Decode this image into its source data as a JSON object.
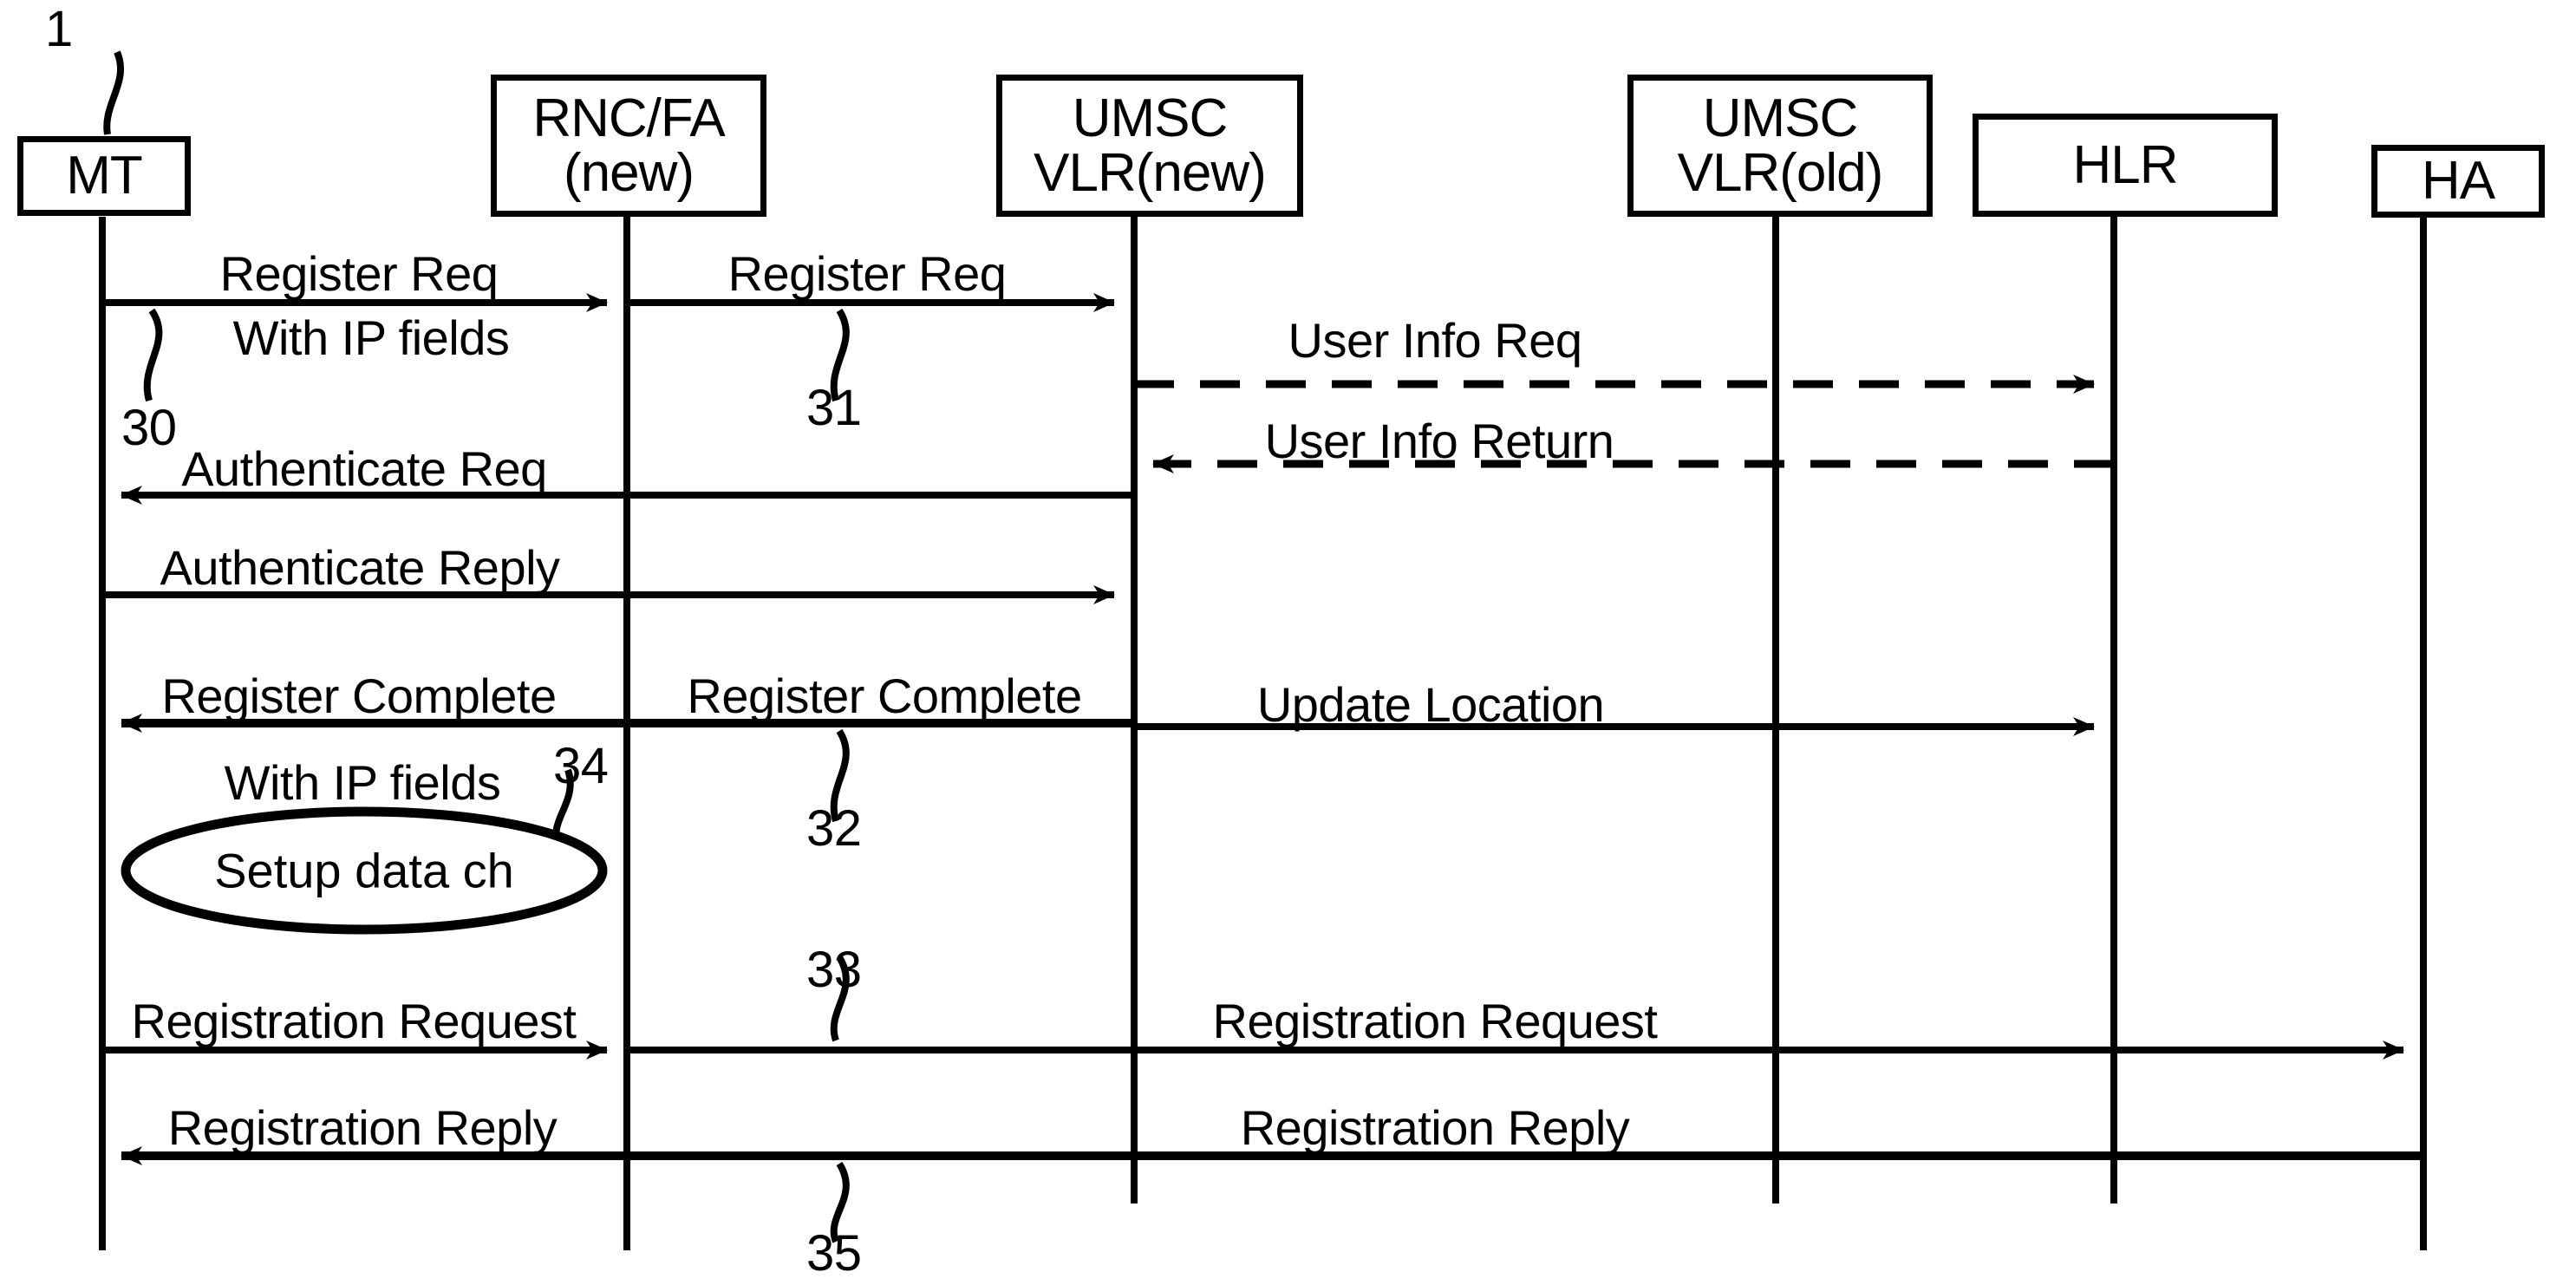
{
  "figure": {
    "label": "1",
    "type": "sequence-diagram"
  },
  "nodes": [
    {
      "id": "mt",
      "name": "MT",
      "lines": [
        "MT"
      ]
    },
    {
      "id": "rncfa",
      "name": "RNC/FA (new)",
      "lines": [
        "RNC/FA",
        "(new)"
      ]
    },
    {
      "id": "umsc_new",
      "name": "UMSC VLR(new)",
      "lines": [
        "UMSC",
        "VLR(new)"
      ]
    },
    {
      "id": "umsc_old",
      "name": "UMSC VLR(old)",
      "lines": [
        "UMSC",
        "VLR(old)"
      ]
    },
    {
      "id": "hlr",
      "name": "HLR",
      "lines": [
        "HLR"
      ]
    },
    {
      "id": "ha",
      "name": "HA",
      "lines": [
        "HA"
      ]
    }
  ],
  "messages": [
    {
      "id": "m1",
      "label": "Register Req",
      "sublabel": "With IP fields",
      "from": "mt",
      "to": "rncfa",
      "style": "solid"
    },
    {
      "id": "m2",
      "label": "Register Req",
      "from": "rncfa",
      "to": "umsc_new",
      "style": "solid"
    },
    {
      "id": "m3",
      "label": "User Info Req",
      "from": "umsc_new",
      "to": "hlr",
      "style": "dashed"
    },
    {
      "id": "m4",
      "label": "User Info Return",
      "from": "hlr",
      "to": "umsc_new",
      "style": "dashed"
    },
    {
      "id": "m5",
      "label": "Authenticate Req",
      "from": "umsc_new",
      "to": "mt",
      "style": "solid"
    },
    {
      "id": "m6",
      "label": "Authenticate Reply",
      "from": "mt",
      "to": "umsc_new",
      "style": "solid"
    },
    {
      "id": "m7",
      "label": "Register Complete",
      "sublabel": "With IP fields",
      "from": "rncfa",
      "to": "mt",
      "style": "solid"
    },
    {
      "id": "m8",
      "label": "Register Complete",
      "from": "umsc_new",
      "to": "rncfa",
      "style": "solid"
    },
    {
      "id": "m9",
      "label": "Update Location",
      "from": "umsc_new",
      "to": "hlr",
      "style": "solid"
    },
    {
      "id": "m10",
      "label": "Registration Request",
      "from": "mt",
      "to": "rncfa",
      "style": "solid"
    },
    {
      "id": "m11",
      "label": "Registration Request",
      "from": "rncfa",
      "to": "ha",
      "style": "solid"
    },
    {
      "id": "m12",
      "label": "Registration Reply",
      "from": "ha",
      "to": "rncfa",
      "style": "solid"
    },
    {
      "id": "m13",
      "label": "Registration Reply",
      "from": "rncfa",
      "to": "mt",
      "style": "solid"
    }
  ],
  "oval": {
    "label": "Setup data ch"
  },
  "reference_numerals": [
    {
      "id": "r1",
      "value": "1"
    },
    {
      "id": "r30",
      "value": "30"
    },
    {
      "id": "r31",
      "value": "31"
    },
    {
      "id": "r32",
      "value": "32"
    },
    {
      "id": "r33",
      "value": "33"
    },
    {
      "id": "r34",
      "value": "34"
    },
    {
      "id": "r35",
      "value": "35"
    }
  ],
  "colors": {
    "stroke": "#000000",
    "background": "#ffffff"
  }
}
